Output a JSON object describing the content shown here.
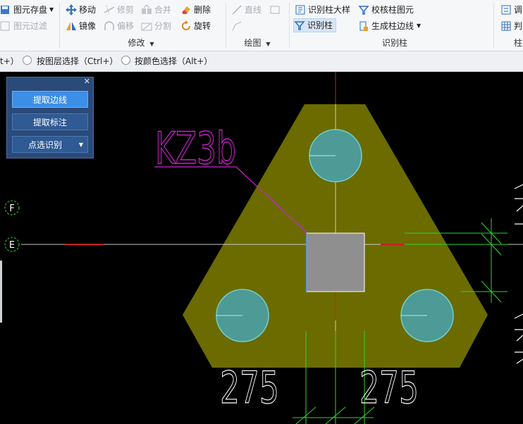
{
  "ribbon": {
    "groups": {
      "modify_label": "修改",
      "draw_label": "绘图",
      "recognize_label": "识别柱"
    },
    "buttons": {
      "save_element": "图元存盘",
      "filter_element": "图元过滤",
      "move": "移动",
      "trim": "修剪",
      "merge": "合并",
      "delete": "删除",
      "mirror": "镜像",
      "offset": "偏移",
      "split": "分割",
      "rotate": "旋转",
      "line": "直线",
      "recognize_column_detail": "识别柱大样",
      "check_column": "校核柱图元",
      "recognize_column": "识别柱",
      "generate_column_edge": "生成柱边线",
      "adjust_partial": "调",
      "judge_partial": "判"
    }
  },
  "selection_bar": {
    "partial_left": "t+）",
    "by_layer": "按图层选择（Ctrl+）",
    "by_color": "按颜色选择（Alt+）"
  },
  "panel": {
    "extract_edge": "提取边线",
    "extract_label": "提取标注",
    "point_recognize": "点选识别"
  },
  "cad": {
    "column_label": "KZ3b",
    "axis_f": "F",
    "axis_e": "E",
    "dim_left": "275",
    "dim_right": "275"
  },
  "colors": {
    "canvas_bg": "#000000",
    "pile_cap_fill": "#6b6b00",
    "pile_fill": "#4e9a96",
    "column_fill": "#8f8f8f",
    "label_color": "#d020d0",
    "axis_green": "#2ad82a",
    "axis_red": "#cc2020",
    "accent_blue": "#3c8fe6"
  }
}
